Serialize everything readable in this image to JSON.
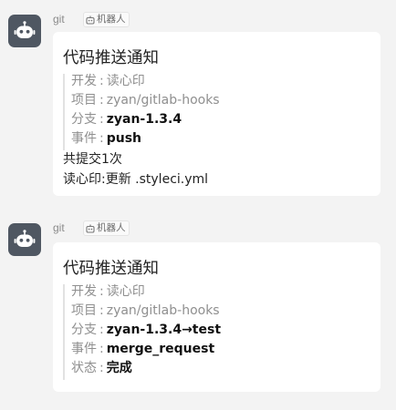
{
  "messages": [
    {
      "sender": "git",
      "tag": "机器人",
      "title": "代码推送通知",
      "fields": [
        {
          "label": "开发",
          "value": "读心印",
          "bold": false
        },
        {
          "label": "项目",
          "value": "zyan/gitlab-hooks",
          "bold": false
        },
        {
          "label": "分支",
          "value": "zyan-1.3.4",
          "bold": true
        },
        {
          "label": "事件",
          "value": "push",
          "bold": true
        }
      ],
      "lines": [
        "共提交1次",
        "读心印:更新 .styleci.yml"
      ]
    },
    {
      "sender": "git",
      "tag": "机器人",
      "title": "代码推送通知",
      "fields": [
        {
          "label": "开发",
          "value": "读心印",
          "bold": false
        },
        {
          "label": "项目",
          "value": "zyan/gitlab-hooks",
          "bold": false
        },
        {
          "label": "分支",
          "value": "zyan-1.3.4→test",
          "bold": true
        },
        {
          "label": "事件",
          "value": "merge_request",
          "bold": true
        },
        {
          "label": "状态",
          "value": "完成",
          "bold": true
        }
      ],
      "lines": []
    }
  ],
  "separator": ":",
  "icons": {
    "avatar": "robot-icon",
    "tag": "robot-icon"
  },
  "colors": {
    "avatar_bg": "#4f5762",
    "card_bg": "#ffffff",
    "page_bg": "#f3f3f3"
  }
}
